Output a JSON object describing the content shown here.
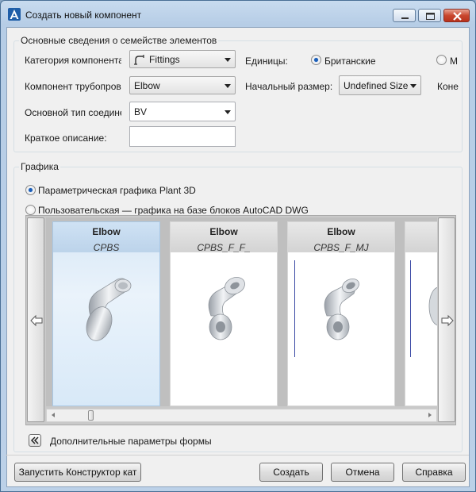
{
  "window": {
    "title": "Создать новый компонент",
    "buttons": [
      "minimize",
      "maximize",
      "close"
    ]
  },
  "family_info": {
    "legend": "Основные сведения о семействе элементов",
    "category_label": "Категория компонента",
    "category_value": "Fittings",
    "component_label": "Компонент трубопровода",
    "component_value": "Elbow",
    "connection_label": "Основной тип соединения",
    "connection_value": "BV",
    "description_label": "Краткое описание:",
    "description_value": "",
    "units_label": "Единицы:",
    "units_british": "Британские",
    "units_metric": "М",
    "units_selected": "british",
    "initial_size_label": "Начальный размер:",
    "initial_size_value": "Undefined Size",
    "end_label": "Коне"
  },
  "graphics": {
    "legend": "Графика",
    "option_parametric": "Параметрическая графика Plant 3D",
    "option_custom": "Пользовательская — графика на базе блоков AutoCAD DWG",
    "selected_option": "parametric",
    "tiles": [
      {
        "name": "Elbow",
        "code": "CPBS",
        "selected": true
      },
      {
        "name": "Elbow",
        "code": "CPBS_F_F_",
        "selected": false
      },
      {
        "name": "Elbow",
        "code": "CPBS_F_MJ",
        "selected": false
      }
    ],
    "scroll_fraction": 0.1
  },
  "more_params": {
    "label": "Дополнительные параметры формы"
  },
  "footer": {
    "designer_button": "Запустить Конструктор кат",
    "create_button": "Создать",
    "cancel_button": "Отмена",
    "help_button": "Справка"
  },
  "colors": {
    "title_bar": "#c8dbef",
    "close_button": "#c9472f",
    "selected_tile": "#d7e7f6",
    "radio_dot": "#1d5fb8"
  }
}
